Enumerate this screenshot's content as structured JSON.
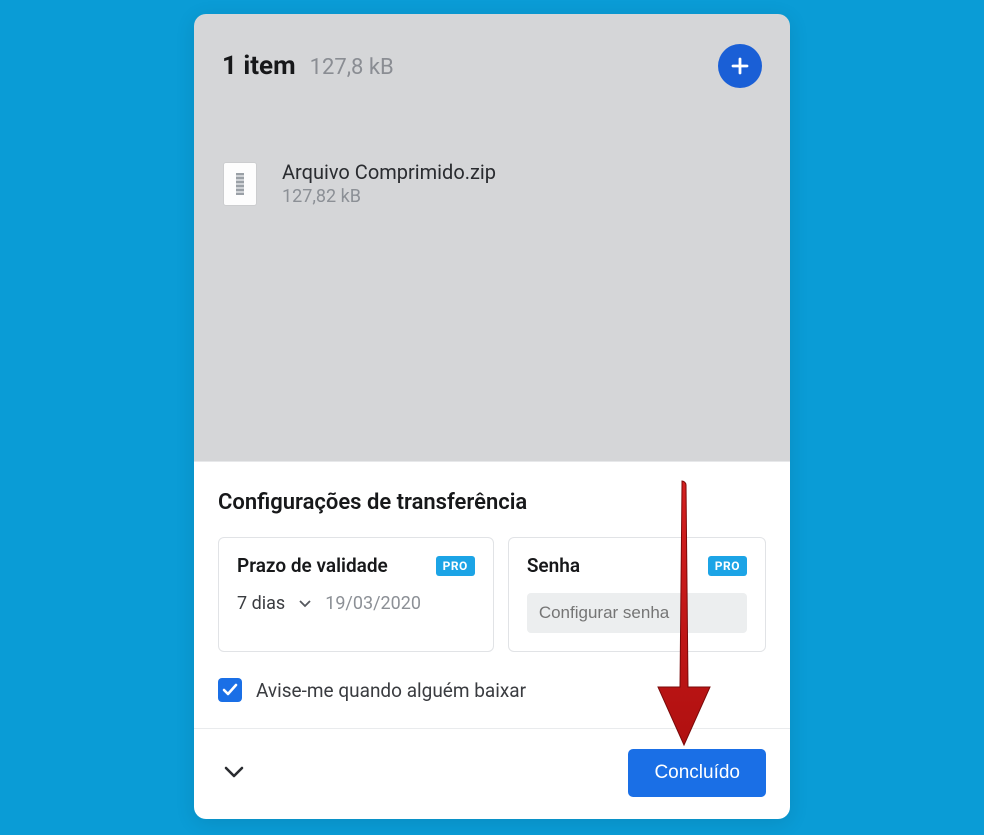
{
  "header": {
    "item_count": "1 item",
    "total_size": "127,8 kB"
  },
  "files": [
    {
      "name": "Arquivo Comprimido.zip",
      "size": "127,82 kB"
    }
  ],
  "settings": {
    "title": "Configurações de transferência",
    "expiry": {
      "label": "Prazo de validade",
      "badge": "PRO",
      "value": "7 dias",
      "date": "19/03/2020"
    },
    "password": {
      "label": "Senha",
      "badge": "PRO",
      "placeholder": "Configurar senha"
    },
    "notify": {
      "label": "Avise-me quando alguém baixar",
      "checked": true
    }
  },
  "footer": {
    "done_label": "Concluído"
  },
  "colors": {
    "primary": "#1a6fe6",
    "accent": "#1ca4e6",
    "bg": "#0a9cd6"
  }
}
